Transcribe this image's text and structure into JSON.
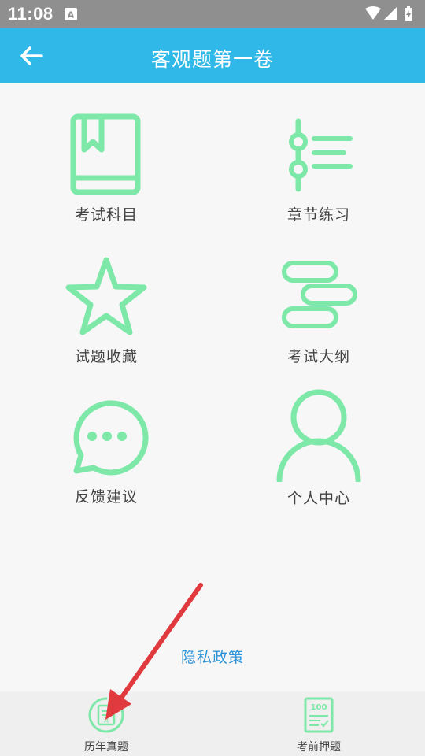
{
  "status_bar": {
    "time": "11:08"
  },
  "app_bar": {
    "title": "客观题第一卷"
  },
  "menu": {
    "items": [
      {
        "label": "考试科目",
        "icon": "book-icon"
      },
      {
        "label": "章节练习",
        "icon": "list-icon"
      },
      {
        "label": "试题收藏",
        "icon": "star-icon"
      },
      {
        "label": "考试大纲",
        "icon": "outline-icon"
      },
      {
        "label": "反馈建议",
        "icon": "chat-icon"
      },
      {
        "label": "个人中心",
        "icon": "person-icon"
      }
    ]
  },
  "privacy_link": "隐私政策",
  "tab_bar": {
    "tabs": [
      {
        "label": "历年真题",
        "icon": "exam-paper-icon"
      },
      {
        "label": "考前押题",
        "icon": "test-score-icon"
      }
    ]
  },
  "colors": {
    "accent": "#2fb8e8",
    "icon_green": "#7de8a8",
    "link": "#2f93d8",
    "annotation_arrow": "#e0393e"
  }
}
